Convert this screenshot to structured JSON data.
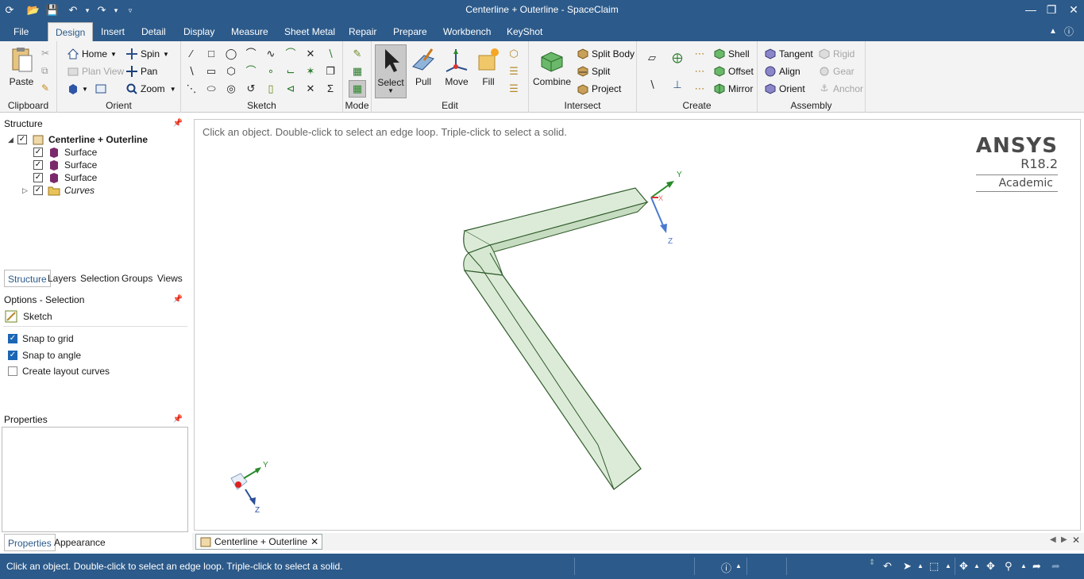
{
  "window": {
    "title": "Centerline + Outerline - SpaceClaim"
  },
  "menu_tabs": [
    {
      "label": "File"
    },
    {
      "label": "Design"
    },
    {
      "label": "Insert"
    },
    {
      "label": "Detail"
    },
    {
      "label": "Display"
    },
    {
      "label": "Measure"
    },
    {
      "label": "Sheet Metal"
    },
    {
      "label": "Repair"
    },
    {
      "label": "Prepare"
    },
    {
      "label": "Workbench"
    },
    {
      "label": "KeyShot"
    }
  ],
  "active_tab": "Design",
  "ribbon": {
    "clipboard": {
      "label": "Clipboard",
      "paste": "Paste"
    },
    "orient": {
      "label": "Orient",
      "home": "Home",
      "spin": "Spin",
      "plan_view": "Plan View",
      "pan": "Pan",
      "zoom": "Zoom"
    },
    "sketch": {
      "label": "Sketch"
    },
    "mode": {
      "label": "Mode"
    },
    "edit": {
      "label": "Edit",
      "select": "Select",
      "pull": "Pull",
      "move": "Move",
      "fill": "Fill"
    },
    "intersect": {
      "label": "Intersect",
      "combine": "Combine",
      "split_body": "Split Body",
      "split": "Split",
      "project": "Project"
    },
    "create": {
      "label": "Create",
      "shell": "Shell",
      "offset": "Offset",
      "mirror": "Mirror"
    },
    "assembly": {
      "label": "Assembly",
      "tangent": "Tangent",
      "align": "Align",
      "orient": "Orient",
      "rigid": "Rigid",
      "gear": "Gear",
      "anchor": "Anchor"
    }
  },
  "structure": {
    "title": "Structure",
    "root": "Centerline + Outerline",
    "items": [
      {
        "label": "Surface"
      },
      {
        "label": "Surface"
      },
      {
        "label": "Surface"
      },
      {
        "label": "Curves"
      }
    ]
  },
  "panel_tabs": [
    "Structure",
    "Layers",
    "Selection",
    "Groups",
    "Views"
  ],
  "options": {
    "title": "Options - Selection",
    "mode": "Sketch",
    "items": [
      {
        "label": "Snap to grid",
        "checked": true
      },
      {
        "label": "Snap to angle",
        "checked": true
      },
      {
        "label": "Create layout curves",
        "checked": false
      }
    ]
  },
  "properties": {
    "title": "Properties",
    "tabs": [
      "Properties",
      "Appearance"
    ]
  },
  "viewport": {
    "hint": "Click an object. Double-click to select an edge loop. Triple-click to select a solid.",
    "logo_name": "ANSYS",
    "logo_version": "R18.2",
    "logo_edition": "Academic",
    "axis_y": "Y",
    "axis_z": "Z",
    "axis_x": "X"
  },
  "document_tab": "Centerline + Outerline",
  "status": {
    "text": "Click an object. Double-click to select an edge loop. Triple-click to select a solid."
  },
  "colors": {
    "chrome": "#2c5a8a",
    "ribbon": "#f3f3f3",
    "model_fill": "#dcebd8",
    "model_edge": "#2f5a2a"
  }
}
